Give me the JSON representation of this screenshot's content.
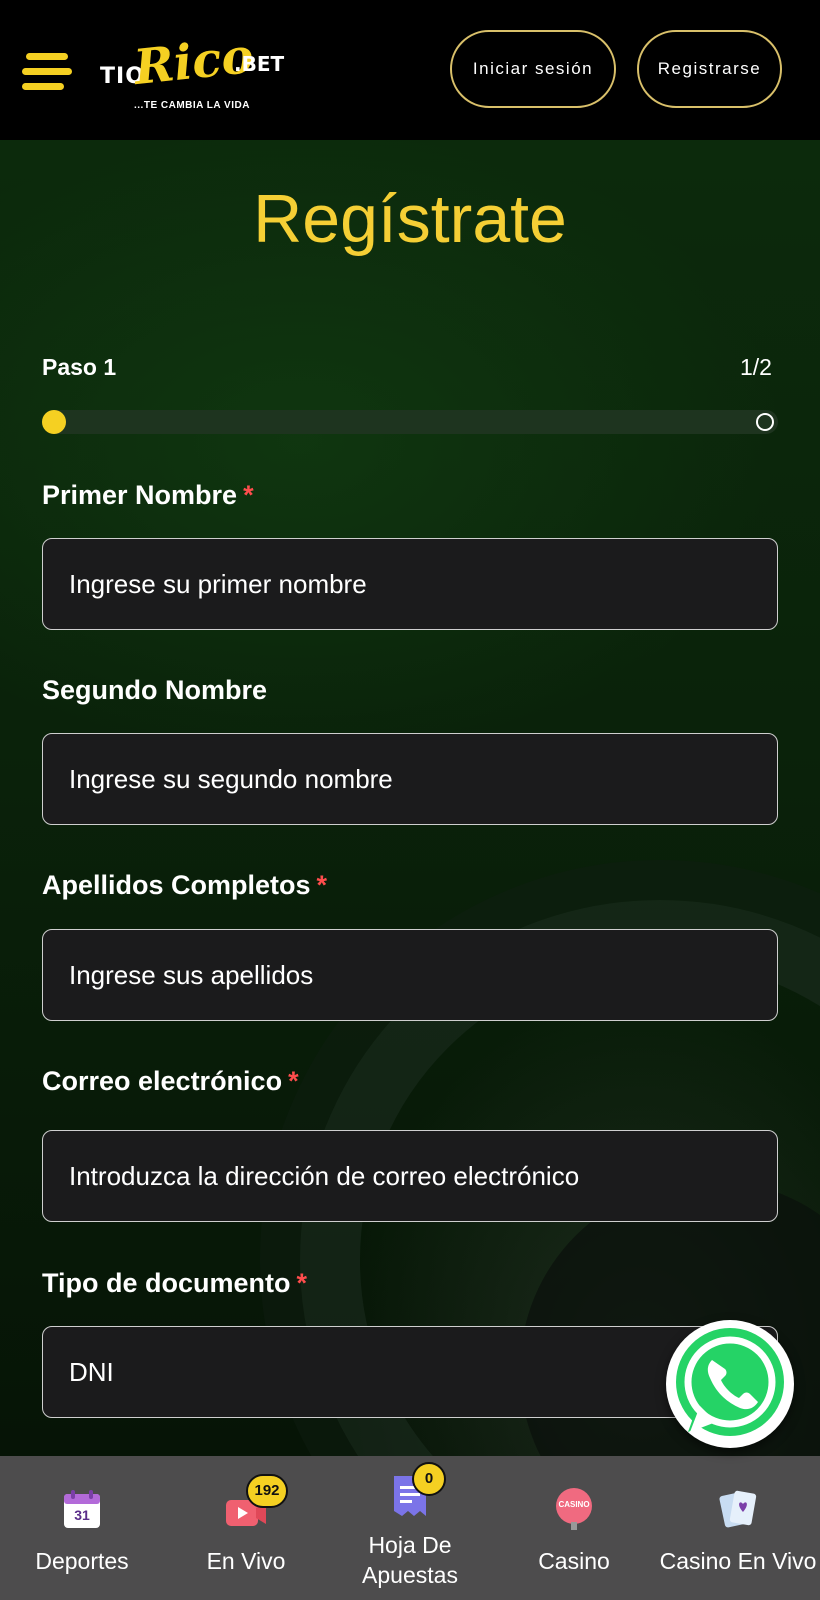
{
  "header": {
    "logo": {
      "tio": "TIO",
      "rico": "Rico",
      "bet": ".BET",
      "tagline": "...TE CAMBIA LA VIDA"
    },
    "login_label": "Iniciar sesión",
    "register_label": "Registrarse"
  },
  "page": {
    "title": "Regístrate",
    "step_label": "Paso 1",
    "step_count": "1/2",
    "progress": 0.0
  },
  "form": {
    "first_name": {
      "label": "Primer Nombre",
      "required": "*",
      "placeholder": "Ingrese su primer nombre"
    },
    "middle_name": {
      "label": "Segundo Nombre",
      "placeholder": "Ingrese su segundo nombre"
    },
    "last_names": {
      "label": "Apellidos Completos",
      "required": "*",
      "placeholder": "Ingrese sus apellidos"
    },
    "email": {
      "label": "Correo electrónico",
      "required": "*",
      "placeholder": "Introduzca la dirección de correo electrónico"
    },
    "doc_type": {
      "label": "Tipo de documento",
      "required": "*",
      "value": "DNI"
    }
  },
  "bottom_nav": {
    "items": [
      {
        "label": "Deportes",
        "icon": "calendar-icon",
        "icon_text": "31"
      },
      {
        "label": "En Vivo",
        "icon": "live-video-icon",
        "badge": "192"
      },
      {
        "label_line1": "Hoja De",
        "label_line2": "Apuestas",
        "icon": "bet-slip-icon",
        "badge": "0"
      },
      {
        "label": "Casino",
        "icon": "casino-sign-icon",
        "icon_text": "CASINO"
      },
      {
        "label": "Casino En Vivo",
        "icon": "playing-cards-icon"
      }
    ]
  },
  "colors": {
    "accent": "#f5d022",
    "required": "#ff4d4d",
    "header_bg": "#000000",
    "nav_bg": "#4d4c4d",
    "whatsapp": "#25d366"
  }
}
